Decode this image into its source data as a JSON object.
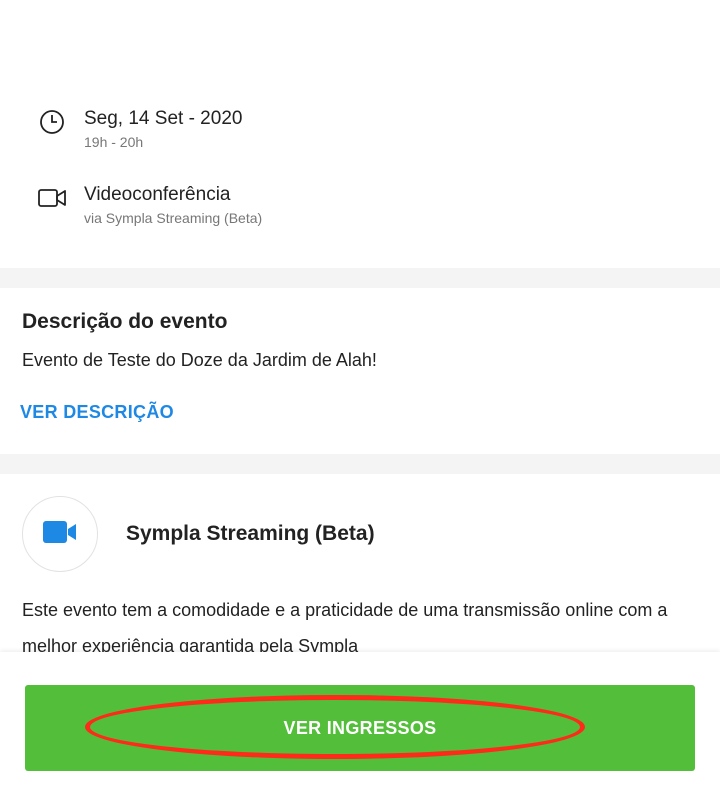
{
  "event": {
    "date": "Seg, 14 Set - 2020",
    "time": "19h - 20h",
    "location_type": "Videoconferência",
    "location_platform": "via Sympla Streaming (Beta)"
  },
  "description": {
    "title": "Descrição do evento",
    "text": "Evento de Teste do Doze da Jardim de Alah!",
    "link_label": "VER DESCRIÇÃO"
  },
  "streaming": {
    "title": "Sympla Streaming (Beta)",
    "text": "Este evento tem a comodidade e a praticidade de uma transmissão online com a melhor experiência garantida pela Sympla"
  },
  "cta": {
    "label": "VER INGRESSOS"
  },
  "icons": {
    "date": "clock-icon",
    "location": "video-camera-icon",
    "streaming": "video-camera-filled-icon"
  },
  "colors": {
    "accent": "#1e88e5",
    "cta": "#52be3a",
    "annotation": "#ff2a1a"
  }
}
